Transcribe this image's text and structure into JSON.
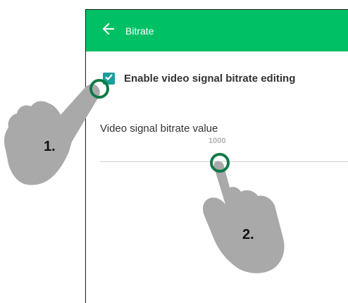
{
  "appbar": {
    "title": "Bitrate",
    "back_icon": "arrow-left-icon",
    "color": "#00c065"
  },
  "settings": {
    "enable_checkbox": {
      "label": "Enable video signal bitrate editing",
      "checked": true,
      "color": "#1a9e9a"
    },
    "bitrate_slider": {
      "title": "Video signal bitrate value",
      "value": "1000"
    }
  },
  "annotations": {
    "step1": "1.",
    "step2": "2.",
    "ring_color": "#0f7a46",
    "hand_color": "#a9a9a9"
  }
}
